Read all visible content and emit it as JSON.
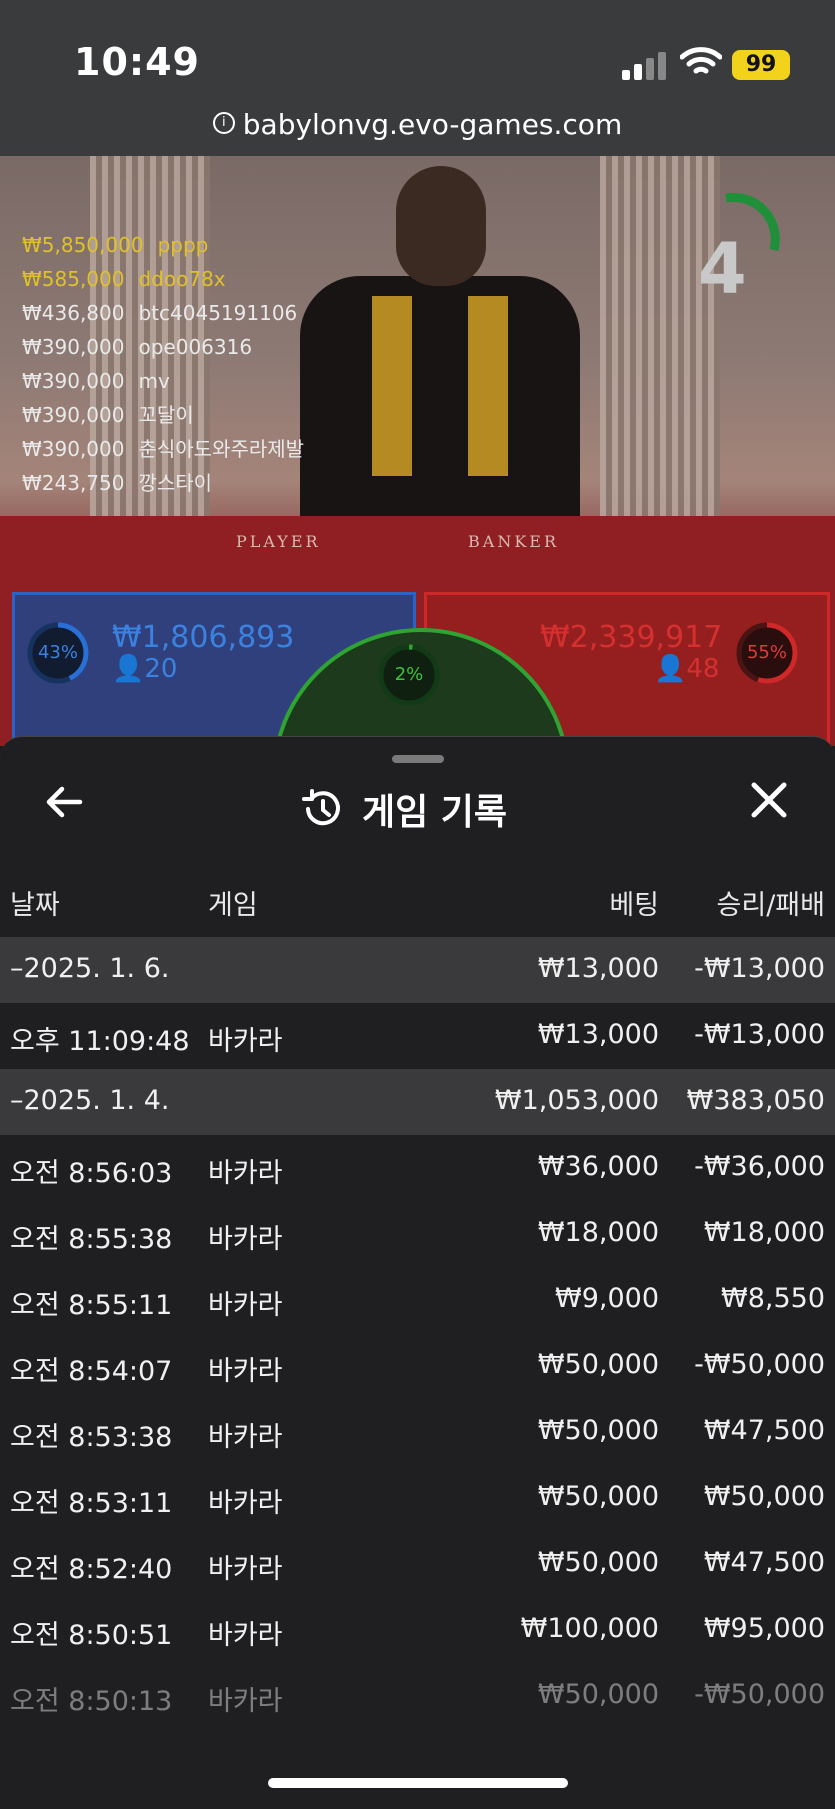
{
  "status": {
    "time": "10:49",
    "battery": "99"
  },
  "browser": {
    "url": "babylonvg.evo-games.com"
  },
  "game": {
    "countdown": "4",
    "top_bets": [
      {
        "amount": "₩5,850,000",
        "user": "pppp",
        "color": "#e0c12a"
      },
      {
        "amount": "₩585,000",
        "user": "ddoo78x",
        "color": "#e0c12a"
      },
      {
        "amount": "₩436,800",
        "user": "btc4045191106",
        "color": "#e9e9e9"
      },
      {
        "amount": "₩390,000",
        "user": "ope006316",
        "color": "#e9e9e9"
      },
      {
        "amount": "₩390,000",
        "user": "mv",
        "color": "#e9e9e9"
      },
      {
        "amount": "₩390,000",
        "user": "꼬달이",
        "color": "#e9e9e9"
      },
      {
        "amount": "₩390,000",
        "user": "춘식아도와주라제발",
        "color": "#e9e9e9"
      },
      {
        "amount": "₩243,750",
        "user": "깡스타이",
        "color": "#e9e9e9"
      }
    ],
    "felt_player": "PLAYER",
    "felt_banker": "BANKER",
    "player": {
      "percent": "43%",
      "percent_value": 43,
      "amount": "₩1,806,893",
      "count": "20",
      "color": "#2a6fd6"
    },
    "banker": {
      "percent": "55%",
      "percent_value": 55,
      "amount": "₩2,339,917",
      "count": "48",
      "color": "#d02828"
    },
    "tie": {
      "percent": "2%",
      "percent_value": 2,
      "color": "#2fa432"
    }
  },
  "history": {
    "title": "게임 기록",
    "columns": {
      "date": "날짜",
      "game": "게임",
      "bet": "베팅",
      "result": "승리/패배"
    },
    "rows": [
      {
        "type": "date",
        "c1": "–2025. 1. 6.",
        "c2": "",
        "c3": "₩13,000",
        "c4": "-₩13,000"
      },
      {
        "type": "entry",
        "c1": "오후 11:09:48",
        "c2": "바카라",
        "c3": "₩13,000",
        "c4": "-₩13,000"
      },
      {
        "type": "date",
        "c1": "–2025. 1. 4.",
        "c2": "",
        "c3": "₩1,053,000",
        "c4": "₩383,050"
      },
      {
        "type": "entry",
        "c1": "오전 8:56:03",
        "c2": "바카라",
        "c3": "₩36,000",
        "c4": "-₩36,000"
      },
      {
        "type": "entry",
        "c1": "오전 8:55:38",
        "c2": "바카라",
        "c3": "₩18,000",
        "c4": "₩18,000"
      },
      {
        "type": "entry",
        "c1": "오전 8:55:11",
        "c2": "바카라",
        "c3": "₩9,000",
        "c4": "₩8,550"
      },
      {
        "type": "entry",
        "c1": "오전 8:54:07",
        "c2": "바카라",
        "c3": "₩50,000",
        "c4": "-₩50,000"
      },
      {
        "type": "entry",
        "c1": "오전 8:53:38",
        "c2": "바카라",
        "c3": "₩50,000",
        "c4": "₩47,500"
      },
      {
        "type": "entry",
        "c1": "오전 8:53:11",
        "c2": "바카라",
        "c3": "₩50,000",
        "c4": "₩50,000"
      },
      {
        "type": "entry",
        "c1": "오전 8:52:40",
        "c2": "바카라",
        "c3": "₩50,000",
        "c4": "₩47,500"
      },
      {
        "type": "entry",
        "c1": "오전 8:50:51",
        "c2": "바카라",
        "c3": "₩100,000",
        "c4": "₩95,000"
      },
      {
        "type": "entry-faded",
        "c1": "오전 8:50:13",
        "c2": "바카라",
        "c3": "₩50,000",
        "c4": "-₩50,000"
      }
    ]
  }
}
